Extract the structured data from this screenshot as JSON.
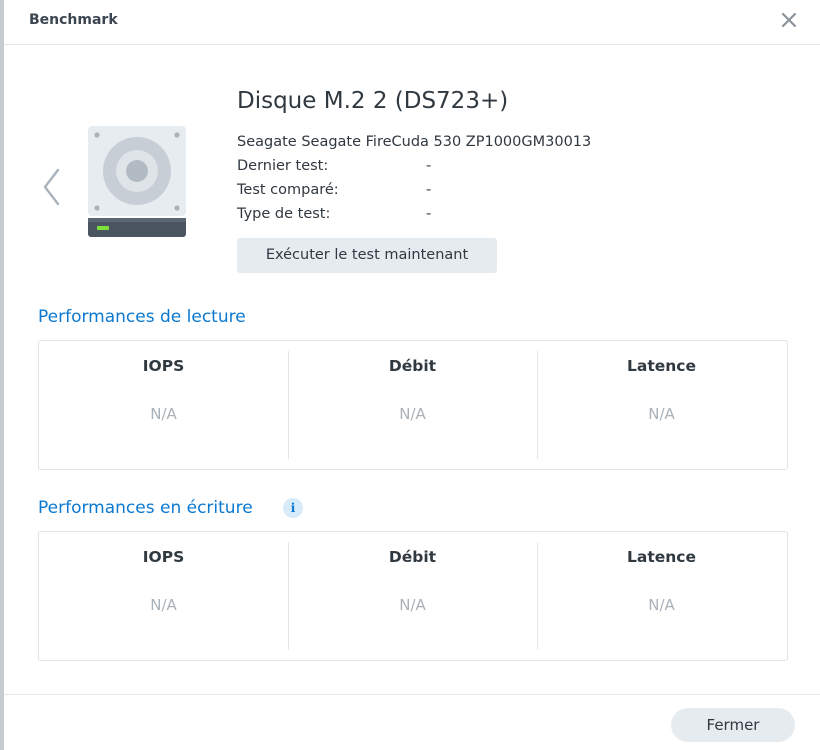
{
  "window": {
    "title": "Benchmark"
  },
  "disk": {
    "name": "Disque M.2 2 (DS723+)",
    "model": "Seagate Seagate FireCuda 530 ZP1000GM30013",
    "info": [
      {
        "label": "Dernier test:",
        "value": "-"
      },
      {
        "label": "Test comparé:",
        "value": "-"
      },
      {
        "label": "Type de test:",
        "value": "-"
      }
    ],
    "run_button": "Exécuter le test maintenant"
  },
  "read": {
    "title": "Performances de lecture",
    "columns": [
      {
        "header": "IOPS",
        "value": "N/A"
      },
      {
        "header": "Débit",
        "value": "N/A"
      },
      {
        "header": "Latence",
        "value": "N/A"
      }
    ]
  },
  "write": {
    "title": "Performances en écriture",
    "info_icon": "info-icon",
    "info_symbol": "i",
    "columns": [
      {
        "header": "IOPS",
        "value": "N/A"
      },
      {
        "header": "Débit",
        "value": "N/A"
      },
      {
        "header": "Latence",
        "value": "N/A"
      }
    ]
  },
  "footer": {
    "close_button": "Fermer"
  },
  "icons": {
    "close": "close-icon",
    "previous": "chevron-left-icon",
    "disk": "hard-disk-icon"
  },
  "colors": {
    "accent": "#0b78d1",
    "text": "#303840",
    "muted": "#a9b1b9",
    "button_bg": "#e6ebf0",
    "disk_led": "#7ee23a"
  }
}
